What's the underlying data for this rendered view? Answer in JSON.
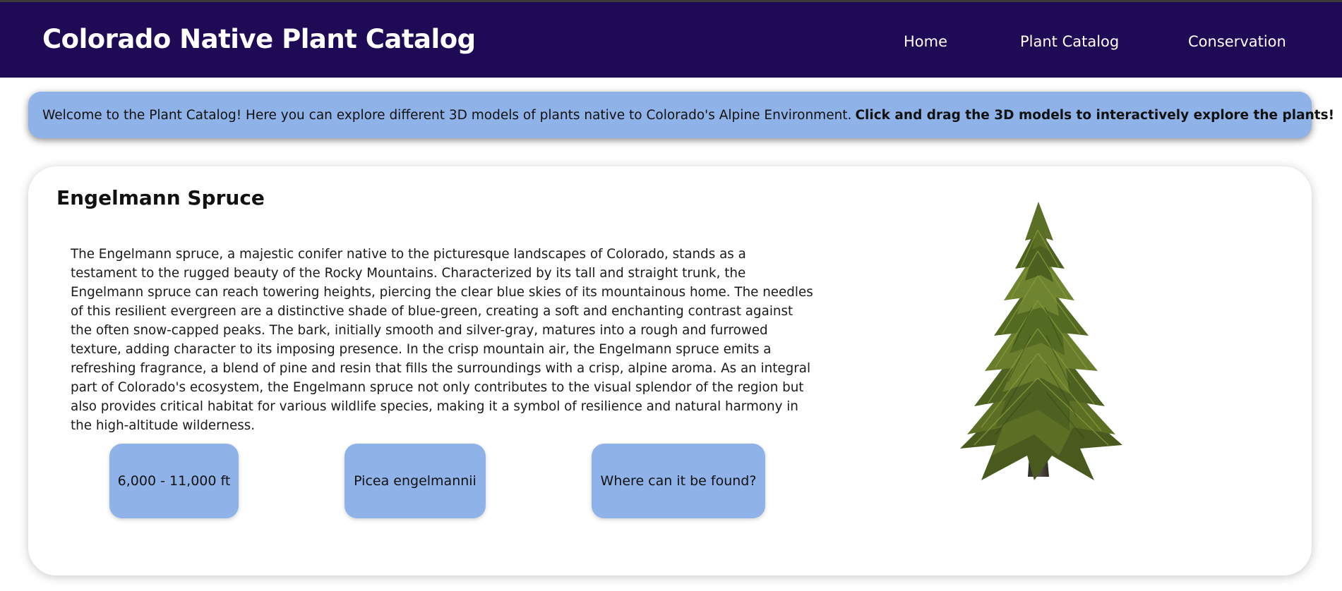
{
  "header": {
    "title": "Colorado Native Plant Catalog",
    "nav": [
      {
        "label": "Home"
      },
      {
        "label": "Plant Catalog"
      },
      {
        "label": "Conservation"
      }
    ],
    "background_color": "#1e0a55"
  },
  "banner": {
    "text": "Welcome to the Plant Catalog! Here you can explore different 3D models of plants native to Colorado's Alpine Environment.",
    "bold_text": "Click and drag the 3D models to interactively explore the plants!",
    "background_color": "#8fb2e8"
  },
  "plant": {
    "name": "Engelmann Spruce",
    "description": "The Engelmann spruce, a majestic conifer native to the picturesque landscapes of Colorado, stands as a testament to the rugged beauty of the Rocky Mountains. Characterized by its tall and straight trunk, the Engelmann spruce can reach towering heights, piercing the clear blue skies of its mountainous home. The needles of this resilient evergreen are a distinctive shade of blue-green, creating a soft and enchanting contrast against the often snow-capped peaks. The bark, initially smooth and silver-gray, matures into a rough and furrowed texture, adding character to its imposing presence. In the crisp mountain air, the Engelmann spruce emits a refreshing fragrance, a blend of pine and resin that fills the surroundings with a crisp, alpine aroma. As an integral part of Colorado's ecosystem, the Engelmann spruce not only contributes to the visual splendor of the region but also provides critical habitat for various wildlife species, making it a symbol of resilience and natural harmony in the high-altitude wilderness.",
    "elevation_button": "6,000 - 11,000 ft",
    "scientific_name_button": "Picea engelmannii",
    "location_button": "Where can it be found?",
    "model_icon": "spruce-tree-3d-model"
  }
}
